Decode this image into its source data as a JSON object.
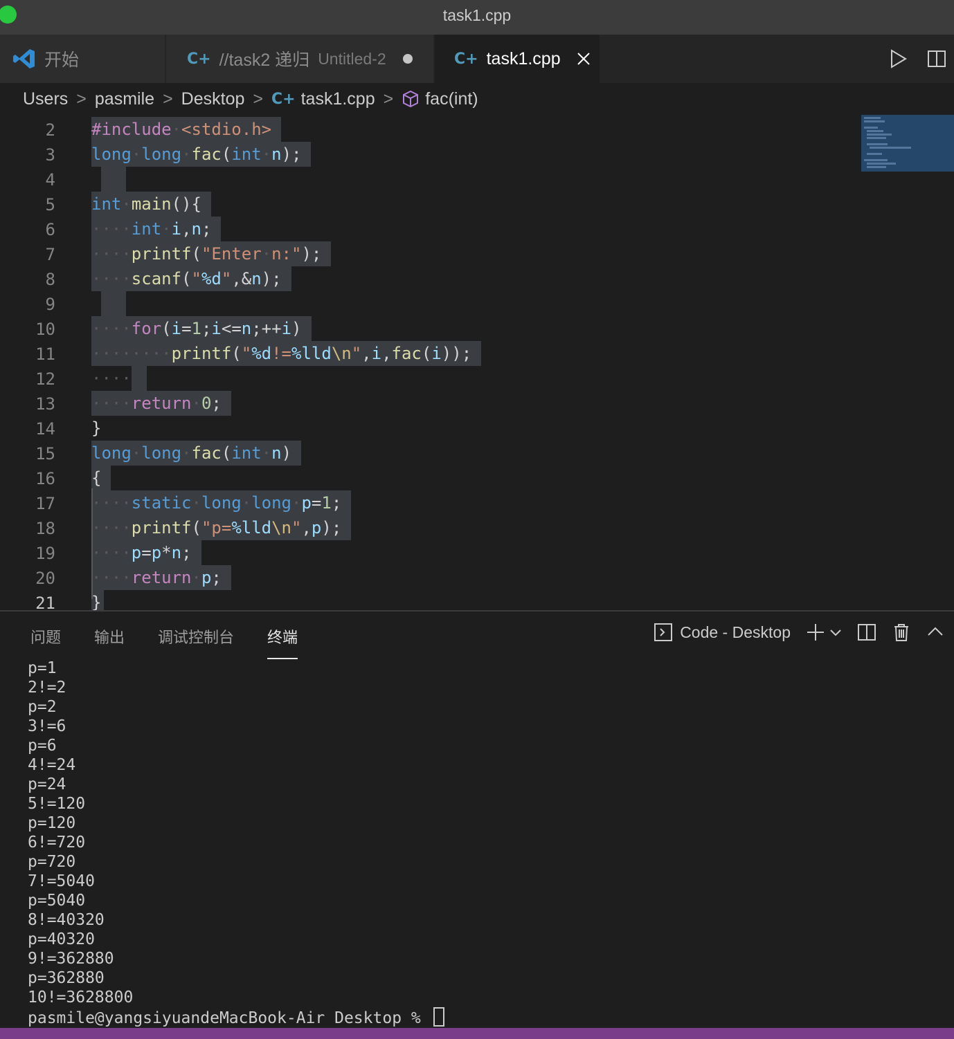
{
  "window": {
    "title": "task1.cpp"
  },
  "tabs": [
    {
      "label": "开始",
      "description": ""
    },
    {
      "label": "//task2 递归",
      "description": "Untitled-2"
    },
    {
      "label": "task1.cpp",
      "description": ""
    }
  ],
  "breadcrumb": [
    "Users",
    "pasmile",
    "Desktop",
    "task1.cpp",
    "fac(int)"
  ],
  "editor": {
    "line_numbers": [
      "2",
      "3",
      "4",
      "5",
      "6",
      "7",
      "8",
      "9",
      "10",
      "11",
      "12",
      "13",
      "14",
      "15",
      "16",
      "17",
      "18",
      "19",
      "20",
      "21"
    ],
    "current_line": "21"
  },
  "panel": {
    "tabs": [
      "问题",
      "输出",
      "调试控制台",
      "终端"
    ],
    "active_tab": "终端",
    "terminal_name": "Code - Desktop",
    "output": [
      "p=1",
      "2!=2",
      "p=2",
      "3!=6",
      "p=6",
      "4!=24",
      "p=24",
      "5!=120",
      "p=120",
      "6!=720",
      "p=720",
      "7!=5040",
      "p=5040",
      "8!=40320",
      "p=40320",
      "9!=362880",
      "p=362880",
      "10!=3628800"
    ],
    "prompt": "pasmile@yangsiyuandeMacBook-Air Desktop % "
  },
  "colors": {
    "accent": "#569cd6",
    "status_bar": "#7a3d8a",
    "selection": "#3a3d41"
  },
  "icons": [
    "vscode-logo-icon",
    "cpp-file-icon",
    "run-icon",
    "split-editor-icon",
    "close-icon",
    "chevron-right-icon",
    "symbol-method-icon",
    "terminal-icon",
    "plus-icon",
    "chevron-down-icon",
    "trash-icon",
    "chevron-up-icon"
  ]
}
